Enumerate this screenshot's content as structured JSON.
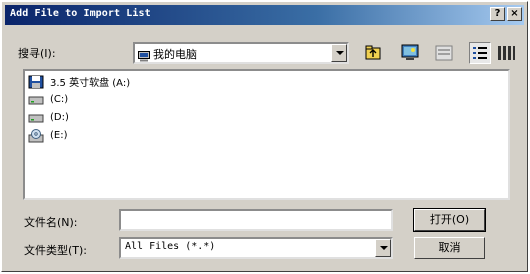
{
  "title": "Add File to Import List",
  "title_buttons": {
    "help": "?",
    "close": "×"
  },
  "lookin": {
    "label": "搜寻(I):",
    "value": "我的电脑"
  },
  "toolbar": [
    "up-folder-icon",
    "desktop-icon",
    "new-folder-icon",
    "list-view-icon",
    "details-view-icon"
  ],
  "items": [
    {
      "label": "3.5 英寸软盘 (A:)",
      "icon": "floppy-drive-icon"
    },
    {
      "label": "(C:)",
      "icon": "hard-drive-icon"
    },
    {
      "label": "(D:)",
      "icon": "hard-drive-icon"
    },
    {
      "label": "(E:)",
      "icon": "cd-drive-icon"
    }
  ],
  "filename": {
    "label": "文件名(N):",
    "value": ""
  },
  "filetype": {
    "label": "文件类型(T):",
    "value": "All Files (*.*)"
  },
  "buttons": {
    "open": "打开(O)",
    "cancel": "取消"
  }
}
